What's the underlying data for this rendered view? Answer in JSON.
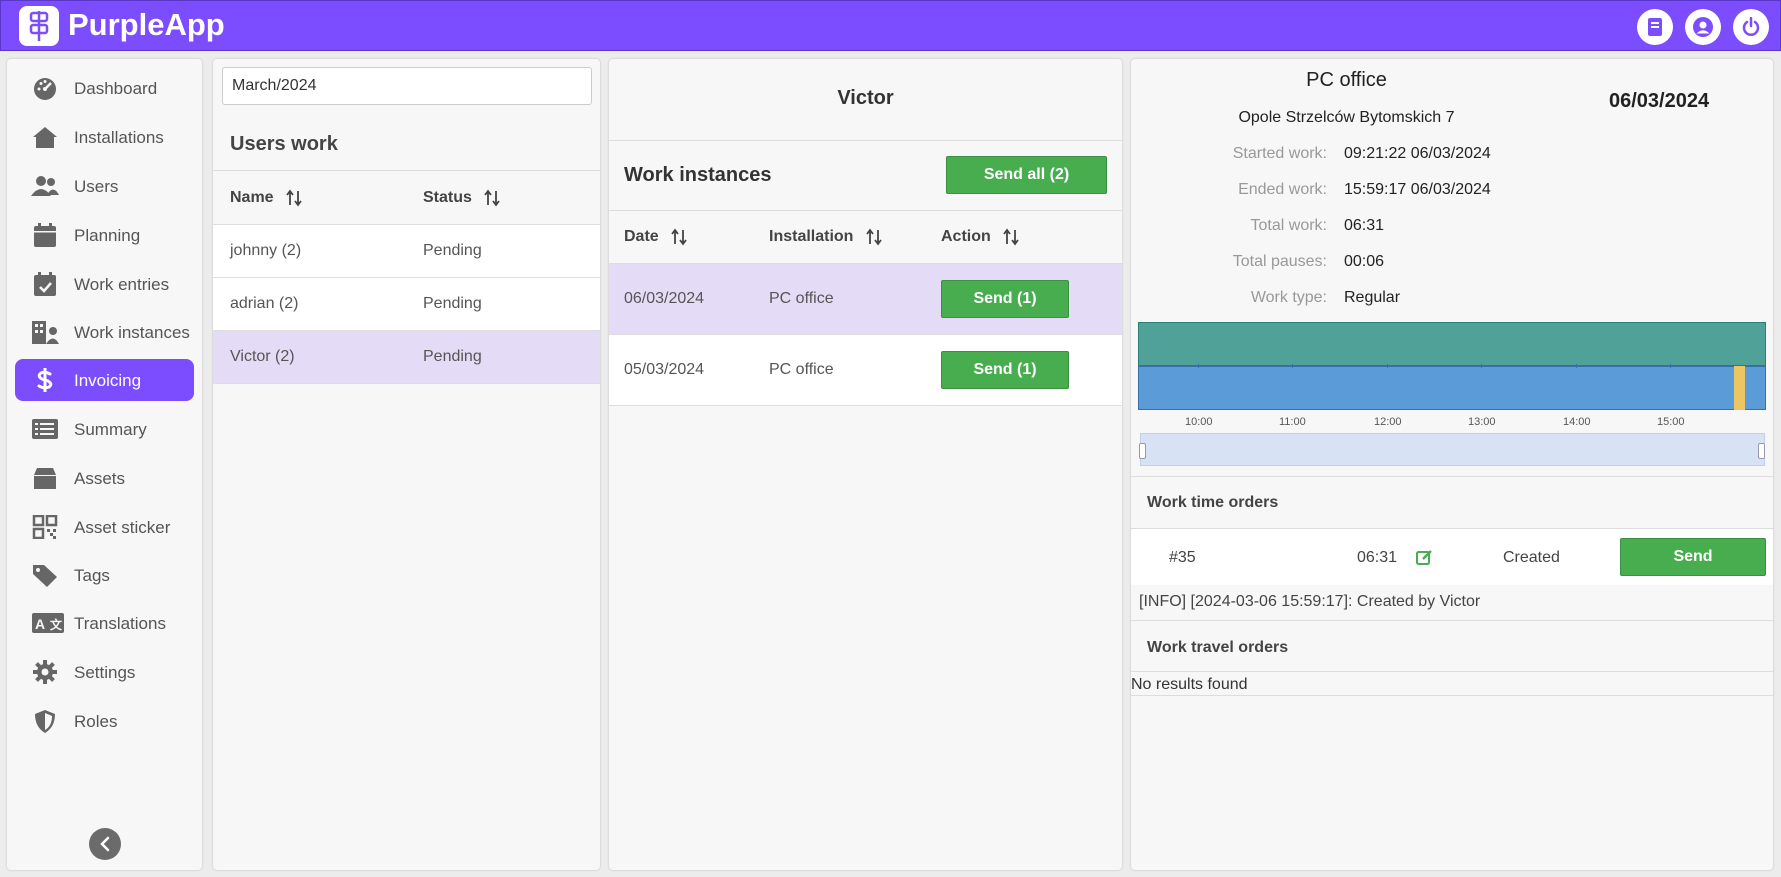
{
  "app": {
    "title": "PurpleApp",
    "accent_color": "#7c4dff",
    "top_icons": [
      "book-icon",
      "user-icon",
      "power-icon"
    ]
  },
  "sidebar": {
    "items": [
      {
        "label": "Dashboard",
        "icon": "gauge-icon"
      },
      {
        "label": "Installations",
        "icon": "home-icon"
      },
      {
        "label": "Users",
        "icon": "users-icon"
      },
      {
        "label": "Planning",
        "icon": "calendar-icon"
      },
      {
        "label": "Work entries",
        "icon": "calendar-check-icon"
      },
      {
        "label": "Work instances",
        "icon": "building-user-icon"
      },
      {
        "label": "Invoicing",
        "icon": "dollar-icon",
        "active": true
      },
      {
        "label": "Summary",
        "icon": "list-icon"
      },
      {
        "label": "Assets",
        "icon": "box-icon"
      },
      {
        "label": "Asset sticker",
        "icon": "qrcode-icon"
      },
      {
        "label": "Tags",
        "icon": "tag-icon"
      },
      {
        "label": "Translations",
        "icon": "language-icon"
      },
      {
        "label": "Settings",
        "icon": "gear-icon"
      },
      {
        "label": "Roles",
        "icon": "shield-icon"
      }
    ]
  },
  "users_panel": {
    "month_value": "March/2024",
    "title": "Users work",
    "columns": [
      "Name",
      "Status"
    ],
    "rows": [
      {
        "name": "johnny (2)",
        "status": "Pending"
      },
      {
        "name": "adrian (2)",
        "status": "Pending"
      },
      {
        "name": "Victor (2)",
        "status": "Pending",
        "selected": true
      }
    ]
  },
  "work_panel": {
    "user": "Victor",
    "title": "Work instances",
    "send_all_label": "Send all (2)",
    "columns": [
      "Date",
      "Installation",
      "Action"
    ],
    "rows": [
      {
        "date": "06/03/2024",
        "installation": "PC office",
        "action": "Send (1)",
        "selected": true
      },
      {
        "date": "05/03/2024",
        "installation": "PC office",
        "action": "Send (1)"
      }
    ]
  },
  "detail": {
    "location": "PC office",
    "address": "Opole Strzelców Bytomskich 7",
    "date": "06/03/2024",
    "fields": [
      {
        "label": "Started work:",
        "value": "09:21:22 06/03/2024"
      },
      {
        "label": "Ended work:",
        "value": "15:59:17 06/03/2024"
      },
      {
        "label": "Total work:",
        "value": "06:31"
      },
      {
        "label": "Total pauses:",
        "value": "00:06"
      },
      {
        "label": "Work type:",
        "value": "Regular"
      }
    ],
    "timeline_labels": [
      "10:00",
      "11:00",
      "12:00",
      "13:00",
      "14:00",
      "15:00"
    ],
    "work_time_orders_title": "Work time orders",
    "order": {
      "id": "#35",
      "duration": "06:31",
      "status": "Created",
      "send_label": "Send"
    },
    "info_line": "[INFO] [2024-03-06 15:59:17]: Created by Victor",
    "work_travel_orders_title": "Work travel orders",
    "no_results": "No results found"
  }
}
